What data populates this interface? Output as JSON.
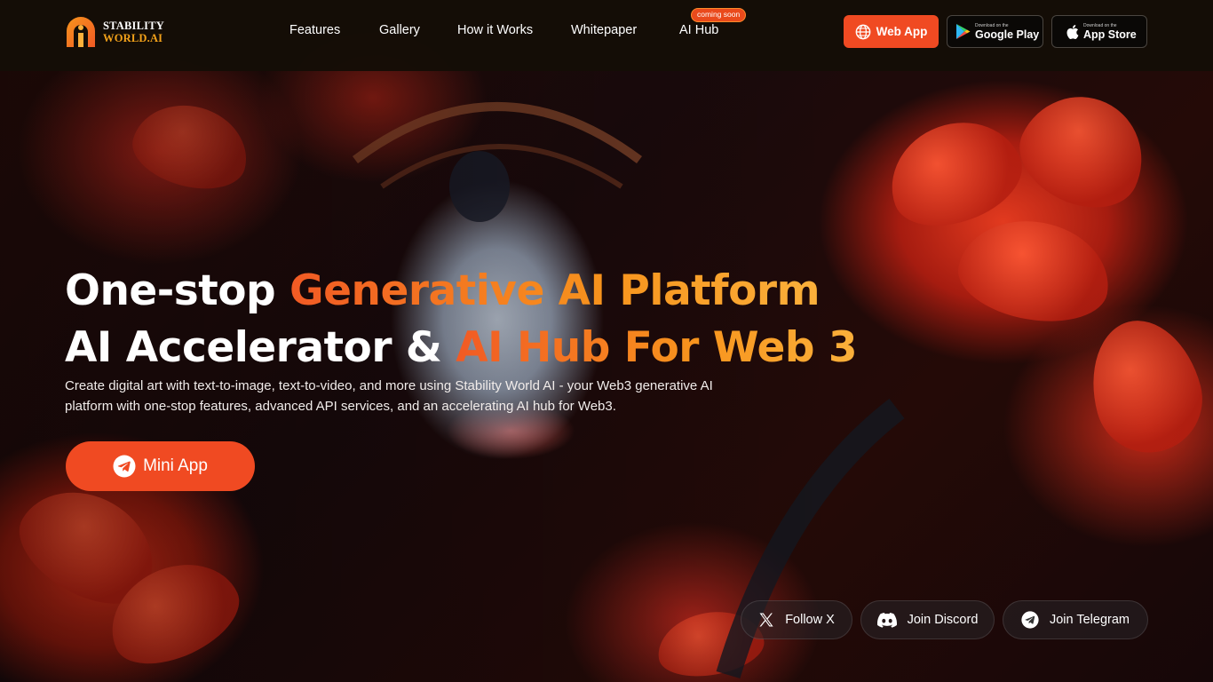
{
  "brand": {
    "line1": "STABILITY",
    "line2": "WORLD.AI"
  },
  "nav": {
    "items": [
      "Features",
      "Gallery",
      "How it Works",
      "Whitepaper",
      "AI Hub"
    ],
    "badge": "coming soon"
  },
  "header_buttons": {
    "web_app": "Web App",
    "google_play": {
      "small": "Download on the",
      "big": "Google Play"
    },
    "app_store": {
      "small": "Download on the",
      "big": "App Store"
    }
  },
  "hero": {
    "line1_white": "One-stop ",
    "line1_accent": "Generative AI Platform",
    "line2_white": "AI Accelerator & ",
    "line2_accent": "AI Hub For Web 3",
    "description": "Create digital art with text-to-image, text-to-video, and more using Stability World AI - your Web3 generative AI platform with one-stop features, advanced API services, and an accelerating AI hub for Web3.",
    "cta": "Mini App"
  },
  "social": [
    {
      "label": "Follow X",
      "icon": "x-icon"
    },
    {
      "label": "Join Discord",
      "icon": "discord-icon"
    },
    {
      "label": "Join Telegram",
      "icon": "telegram-icon"
    }
  ],
  "colors": {
    "accent": "#f04a22",
    "gold": "#f7941d",
    "header_bg": "#140e06"
  }
}
